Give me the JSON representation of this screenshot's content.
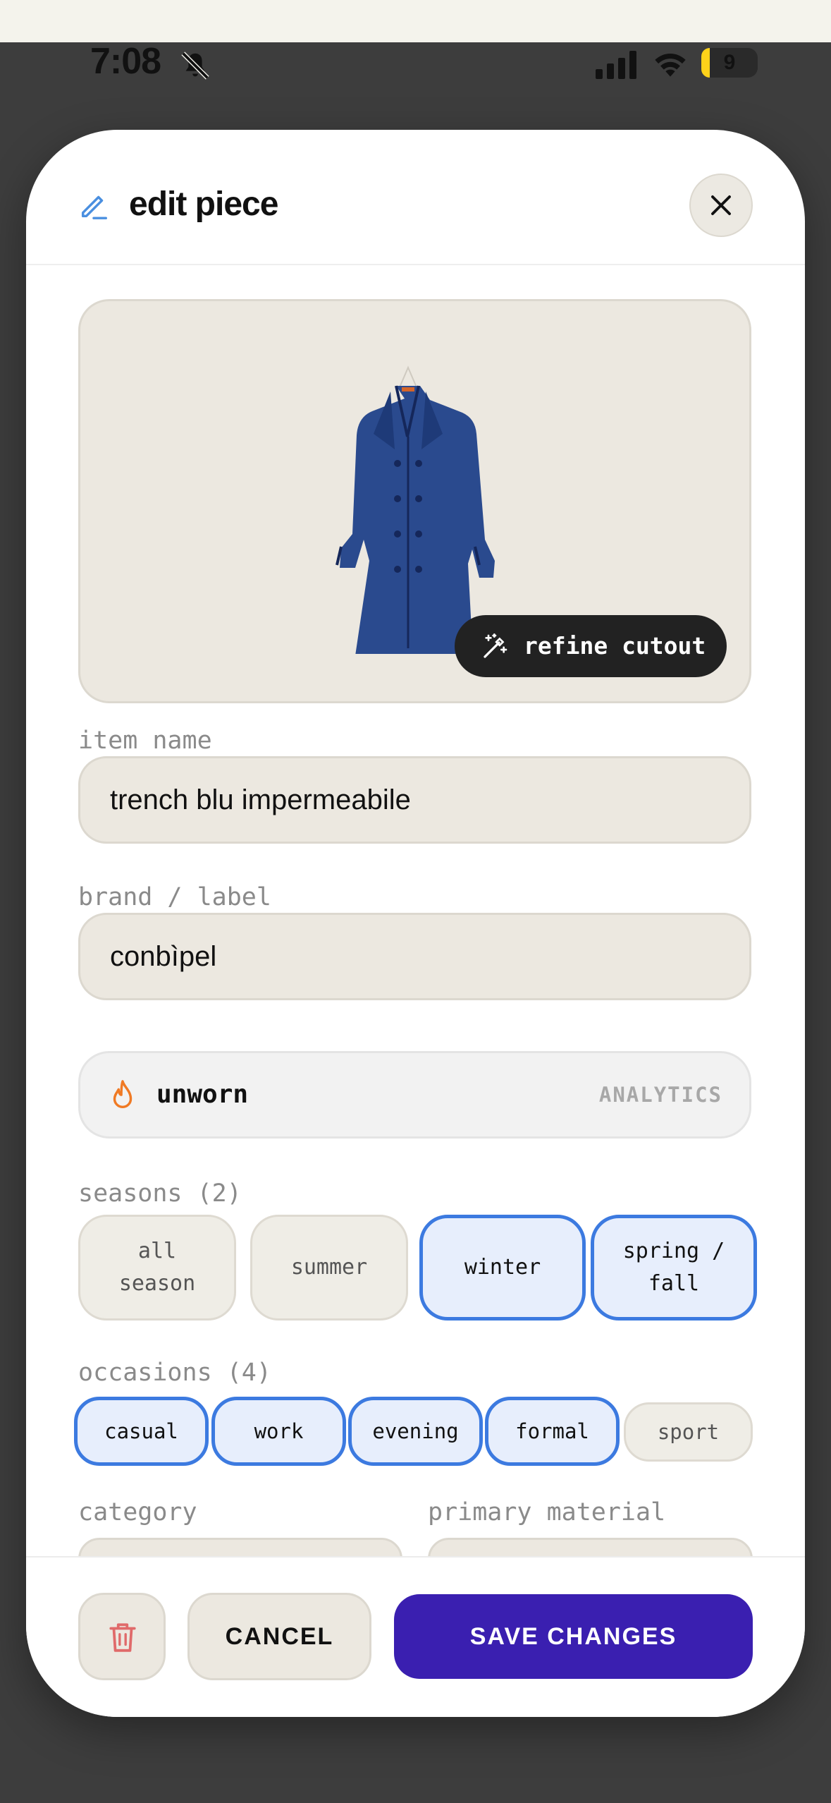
{
  "status_bar": {
    "time": "7:08",
    "battery": "9"
  },
  "header": {
    "title": "edit piece"
  },
  "image": {
    "refine_label": "refine cutout"
  },
  "fields": {
    "item_name_label": "item name",
    "item_name_value": "trench blu impermeabile",
    "brand_label": "brand / label",
    "brand_value": "conbìpel"
  },
  "analytics": {
    "status": "unworn",
    "label": "ANALYTICS"
  },
  "seasons": {
    "label": "seasons (2)",
    "options": [
      {
        "line1": "all",
        "line2": "season",
        "selected": false
      },
      {
        "line1": "summer",
        "line2": "",
        "selected": false
      },
      {
        "line1": "winter",
        "line2": "",
        "selected": true
      },
      {
        "line1": "spring /",
        "line2": "fall",
        "selected": true
      }
    ]
  },
  "occasions": {
    "label": "occasions (4)",
    "options": [
      {
        "label": "casual",
        "selected": true
      },
      {
        "label": "work",
        "selected": true
      },
      {
        "label": "evening",
        "selected": true
      },
      {
        "label": "formal",
        "selected": true
      },
      {
        "label": "sport",
        "selected": false
      }
    ]
  },
  "details": {
    "category_label": "category",
    "material_label": "primary material"
  },
  "footer": {
    "cancel_label": "CANCEL",
    "save_label": "SAVE CHANGES"
  },
  "colors": {
    "accent": "#3a1fb0",
    "selected_border": "#3c7ae0",
    "sheet_bg": "#ffffff",
    "field_bg": "#ece8e0",
    "delete": "#e06a6a"
  }
}
